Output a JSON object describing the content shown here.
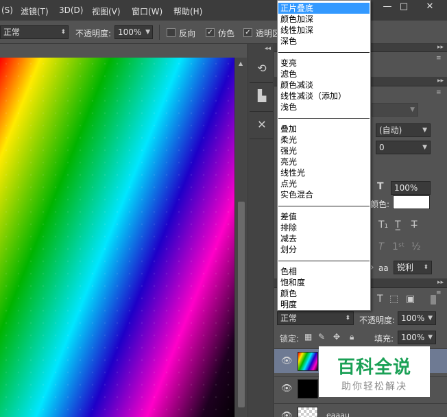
{
  "menu": {
    "items": [
      "(S)",
      "滤镜(T)",
      "3D(D)",
      "视图(V)",
      "窗口(W)",
      "帮助(H)"
    ],
    "window_controls": [
      "—",
      "□",
      "✕"
    ]
  },
  "options": {
    "mode_value": "正常",
    "opacity_label": "不透明度:",
    "opacity_value": "100%",
    "reverse_label": "反向",
    "dither_label": "仿色",
    "transparency_label": "透明区"
  },
  "blend_modes": {
    "groups": [
      [
        "正片叠底",
        "颜色加深",
        "线性加深",
        "深色"
      ],
      [
        "变亮",
        "滤色",
        "颜色减淡",
        "线性减淡（添加）",
        "浅色"
      ],
      [
        "叠加",
        "柔光",
        "强光",
        "亮光",
        "线性光",
        "点光",
        "实色混合"
      ],
      [
        "差值",
        "排除",
        "减去",
        "划分"
      ],
      [
        "色相",
        "饱和度",
        "颜色",
        "明度"
      ]
    ],
    "highlighted": "正片叠底"
  },
  "character": {
    "font_style": "(自动)",
    "tracking": "0",
    "scale": "100%",
    "color_label": "颜色:",
    "antialias": "锐利",
    "aa_icon": "aa"
  },
  "layers": {
    "mode_value": "正常",
    "opacity_label": "不透明度:",
    "opacity_value": "100%",
    "lock_label": "锁定:",
    "fill_label": "填充:",
    "fill_value": "100%",
    "rows": [
      {
        "name": ""
      },
      {
        "name": ""
      },
      {
        "name": "eaaau"
      }
    ]
  },
  "watermark": {
    "title": "百科全说",
    "subtitle": "助你轻松解决"
  },
  "colors": {
    "highlight": "#3399ff",
    "watermark_green": "#1aa055",
    "selected_layer": "#6e7a93"
  }
}
